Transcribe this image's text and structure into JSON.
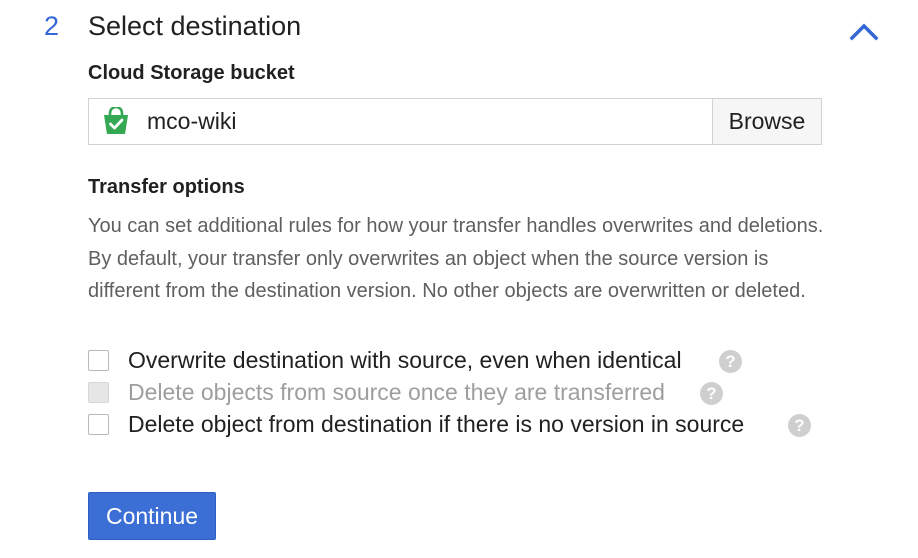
{
  "step": {
    "number": "2",
    "title": "Select destination",
    "collapse_icon": "chevron-up-icon"
  },
  "bucket": {
    "label": "Cloud Storage bucket",
    "icon": "bucket-icon",
    "value": "mco-wiki",
    "browse_label": "Browse"
  },
  "transfer_options": {
    "title": "Transfer options",
    "description": "You can set additional rules for how your transfer handles overwrites and deletions. By default, your transfer only overwrites an object when the source version is different from the destination version. No other objects are overwritten or deleted.",
    "options": [
      {
        "label": "Overwrite destination with source, even when identical",
        "checked": false,
        "disabled": false
      },
      {
        "label": "Delete objects from source once they are transferred",
        "checked": false,
        "disabled": true
      },
      {
        "label": "Delete object from destination if there is no version in source",
        "checked": false,
        "disabled": false
      }
    ],
    "help_glyph": "?"
  },
  "continue_label": "Continue",
  "colors": {
    "accent": "#3367d6",
    "button": "#3b6fd6",
    "bucket_icon": "#34a853"
  }
}
